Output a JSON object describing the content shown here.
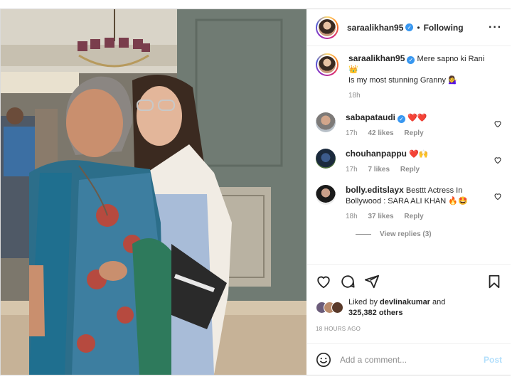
{
  "post": {
    "username": "saraalikhan95",
    "follow_status": "Following",
    "more_icon": "more-options-icon",
    "caption": {
      "username": "saraalikhan95",
      "line1": "Mere sapno ki Rani",
      "emoji1": "👑",
      "line2": "Is my most stunning Granny",
      "emoji2": "💁‍♀️",
      "time": "18h"
    }
  },
  "comments": [
    {
      "username": "sabapataudi",
      "verified": true,
      "text": "",
      "emoji": "❤️❤️",
      "time": "17h",
      "likes": "42 likes",
      "reply": "Reply"
    },
    {
      "username": "chouhanpappu",
      "verified": false,
      "text": "",
      "emoji": "❤️🙌",
      "time": "17h",
      "likes": "7 likes",
      "reply": "Reply"
    },
    {
      "username": "bolly.editslayx",
      "verified": false,
      "text": "Besttt Actress In Bollywood : SARA ALI KHAN",
      "emoji": "🔥🤩",
      "time": "18h",
      "likes": "37 likes",
      "reply": "Reply"
    }
  ],
  "view_replies": "View replies (3)",
  "actions": {
    "like_icon": "heart-icon",
    "comment_icon": "comment-icon",
    "share_icon": "share-icon",
    "save_icon": "bookmark-icon"
  },
  "likes": {
    "prefix": "Liked by",
    "user": "devlinakumar",
    "and": "and",
    "others": "325,382 others"
  },
  "timestamp": "18 HOURS AGO",
  "add_comment": {
    "placeholder": "Add a comment...",
    "post_label": "Post"
  },
  "colors": {
    "verified": "#3897f0",
    "heart": "#ed4956",
    "post_disabled": "#b2dffc",
    "muted": "#8e8e8e"
  }
}
